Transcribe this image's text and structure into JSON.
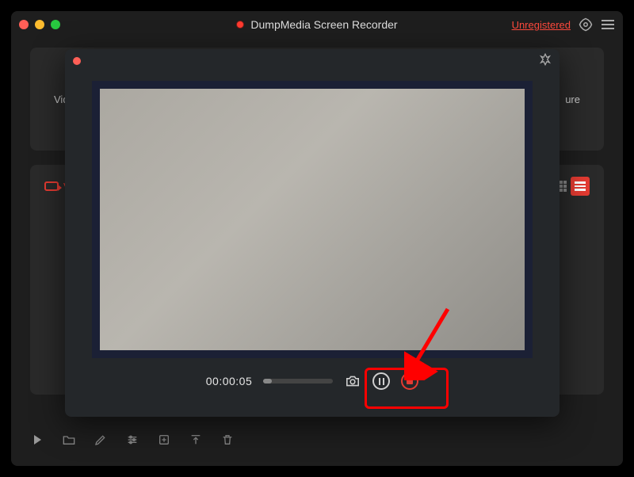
{
  "app": {
    "title": "DumpMedia Screen Recorder",
    "registration_status": "Unregistered"
  },
  "main": {
    "modes": {
      "video": "Video",
      "capture_end": "ure"
    },
    "tabs": {
      "video_label_partial": "V"
    },
    "icon_names": {
      "play": "play-icon",
      "folder": "folder-icon",
      "edit": "edit-icon",
      "settings": "settings-lines-icon",
      "export": "export-icon",
      "upload": "upload-icon",
      "trash": "trash-icon"
    }
  },
  "overlay": {
    "timecode": "00:00:05"
  },
  "colors": {
    "accent_red": "#e53b32",
    "bg_dark": "#1e1e1e",
    "overlay_bg": "#24272a",
    "preview_border": "#1b2035"
  }
}
